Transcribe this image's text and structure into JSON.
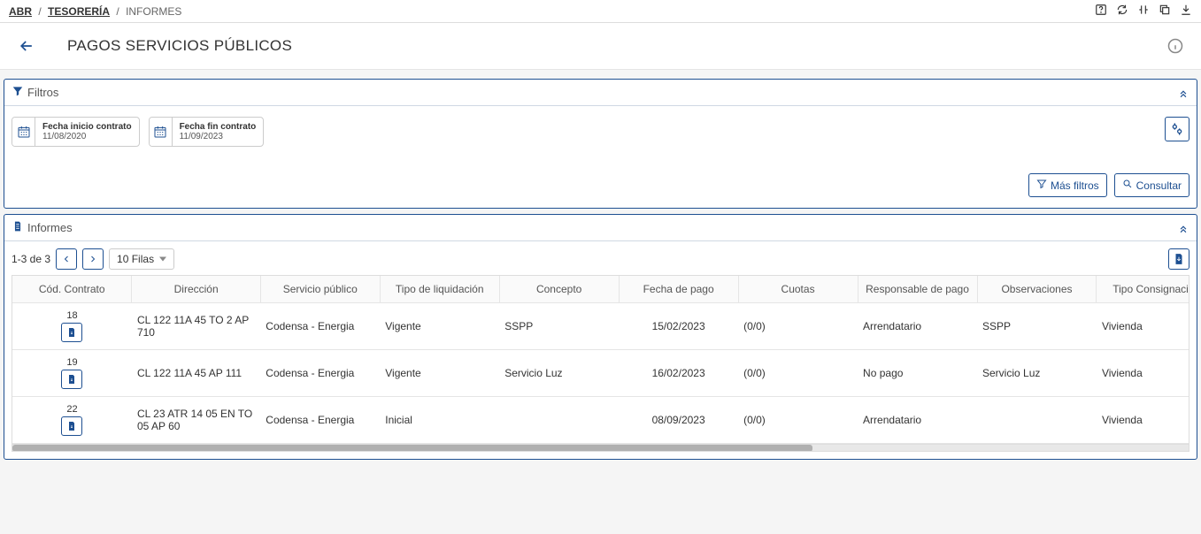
{
  "breadcrumb": {
    "a": "ABR",
    "b": "TESORERÍA",
    "c": "INFORMES"
  },
  "page": {
    "title": "PAGOS SERVICIOS PÚBLICOS"
  },
  "filters": {
    "panel_title": "Filtros",
    "pill1": {
      "label": "Fecha inicio contrato",
      "value": "11/08/2020"
    },
    "pill2": {
      "label": "Fecha fin contrato",
      "value": "11/09/2023"
    },
    "more_filters_label": "Más filtros",
    "consultar_label": "Consultar"
  },
  "informes": {
    "panel_title": "Informes",
    "page_info": "1-3 de 3",
    "rows_label": "10 Filas"
  },
  "table": {
    "headers": {
      "codigo": "Cód. Contrato",
      "direccion": "Dirección",
      "servicio": "Servicio público",
      "tipoliq": "Tipo de liquidación",
      "concepto": "Concepto",
      "fecha": "Fecha de pago",
      "cuotas": "Cuotas",
      "responsable": "Responsable de pago",
      "obs": "Observaciones",
      "tipoc": "Tipo Consignación"
    },
    "rows": [
      {
        "codigo": "18",
        "direccion": "CL 122 11A 45 TO 2 AP 710",
        "servicio": "Codensa - Energia",
        "tipoliq": "Vigente",
        "concepto": "SSPP",
        "fecha": "15/02/2023",
        "cuotas": "(0/0)",
        "responsable": "Arrendatario",
        "obs": "SSPP",
        "tipoc": "Vivienda"
      },
      {
        "codigo": "19",
        "direccion": "CL 122 11A 45 AP 111",
        "servicio": "Codensa - Energia",
        "tipoliq": "Vigente",
        "concepto": "Servicio Luz",
        "fecha": "16/02/2023",
        "cuotas": "(0/0)",
        "responsable": "No pago",
        "obs": "Servicio Luz",
        "tipoc": "Vivienda"
      },
      {
        "codigo": "22",
        "direccion": "CL 23 ATR 14 05 EN TO 05 AP 60",
        "servicio": "Codensa - Energia",
        "tipoliq": "Inicial",
        "concepto": "",
        "fecha": "08/09/2023",
        "cuotas": "(0/0)",
        "responsable": "Arrendatario",
        "obs": "",
        "tipoc": "Vivienda"
      }
    ]
  }
}
